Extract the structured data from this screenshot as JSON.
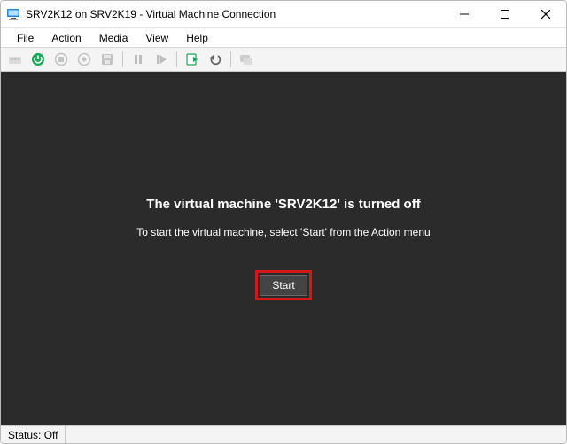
{
  "window": {
    "title": "SRV2K12 on SRV2K19 - Virtual Machine Connection"
  },
  "menu": {
    "items": [
      "File",
      "Action",
      "Media",
      "View",
      "Help"
    ]
  },
  "toolbar": {
    "icons": [
      "ctrl-alt-del-icon",
      "start-icon",
      "turnoff-icon",
      "shutdown-icon",
      "save-icon",
      "pause-icon",
      "reset-icon",
      "checkpoint-icon",
      "revert-icon",
      "enhanced-session-icon"
    ]
  },
  "vm": {
    "title": "The virtual machine 'SRV2K12' is turned off",
    "subtitle": "To start the virtual machine, select 'Start' from the Action menu",
    "start_label": "Start"
  },
  "status": {
    "text": "Status: Off"
  }
}
